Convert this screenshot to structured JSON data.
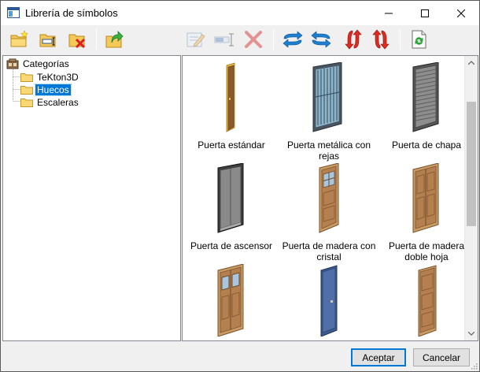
{
  "window": {
    "title": "Librería de símbolos",
    "minimize_label": "Minimizar",
    "maximize_label": "Maximizar",
    "close_label": "Cerrar"
  },
  "toolbar": {
    "buttons": [
      {
        "icon": "new-folder-icon",
        "enabled": true
      },
      {
        "icon": "rename-folder-icon",
        "enabled": true
      },
      {
        "icon": "delete-folder-icon",
        "enabled": true
      },
      {
        "icon": "folder-up-icon",
        "enabled": true
      },
      {
        "icon": "edit-symbol-icon",
        "enabled": false
      },
      {
        "icon": "rename-symbol-icon",
        "enabled": false
      },
      {
        "icon": "delete-symbol-icon",
        "enabled": false
      },
      {
        "icon": "flip-horizontal-icon",
        "enabled": true
      },
      {
        "icon": "flip-horizontal-reverse-icon",
        "enabled": true
      },
      {
        "icon": "flip-vertical-icon",
        "enabled": true
      },
      {
        "icon": "flip-vertical-reverse-icon",
        "enabled": true
      },
      {
        "icon": "refresh-icon",
        "enabled": true
      }
    ]
  },
  "tree": {
    "root": {
      "label": "Categorías",
      "icon": "categories-icon"
    },
    "children": [
      {
        "label": "TeKton3D",
        "selected": false
      },
      {
        "label": "Huecos",
        "selected": true
      },
      {
        "label": "Escaleras",
        "selected": false
      }
    ]
  },
  "symbols": [
    {
      "caption": [
        "Puerta estándar"
      ],
      "kind": "standard"
    },
    {
      "caption": [
        "Puerta metálica con",
        "rejas"
      ],
      "kind": "metal-bars"
    },
    {
      "caption": [
        "Puerta de chapa"
      ],
      "kind": "sheet"
    },
    {
      "caption": [
        "Puerta de ascensor"
      ],
      "kind": "elevator"
    },
    {
      "caption": [
        "Puerta de madera con",
        "cristal"
      ],
      "kind": "wood-glass"
    },
    {
      "caption": [
        "Puerta de madera",
        "doble hoja"
      ],
      "kind": "wood-double"
    },
    {
      "caption": [
        ""
      ],
      "kind": "wood-double-glass"
    },
    {
      "caption": [
        ""
      ],
      "kind": "blue"
    },
    {
      "caption": [
        ""
      ],
      "kind": "wood-panel"
    }
  ],
  "footer": {
    "accept_label": "Aceptar",
    "cancel_label": "Cancelar"
  },
  "colors": {
    "selection": "#0078d7",
    "door_wood": "#b5804f",
    "door_frame": "#d9b57b",
    "metal_door": "#8ea3b3",
    "sheet_door": "#6b6b6b",
    "blue_door": "#4f6fa6"
  }
}
